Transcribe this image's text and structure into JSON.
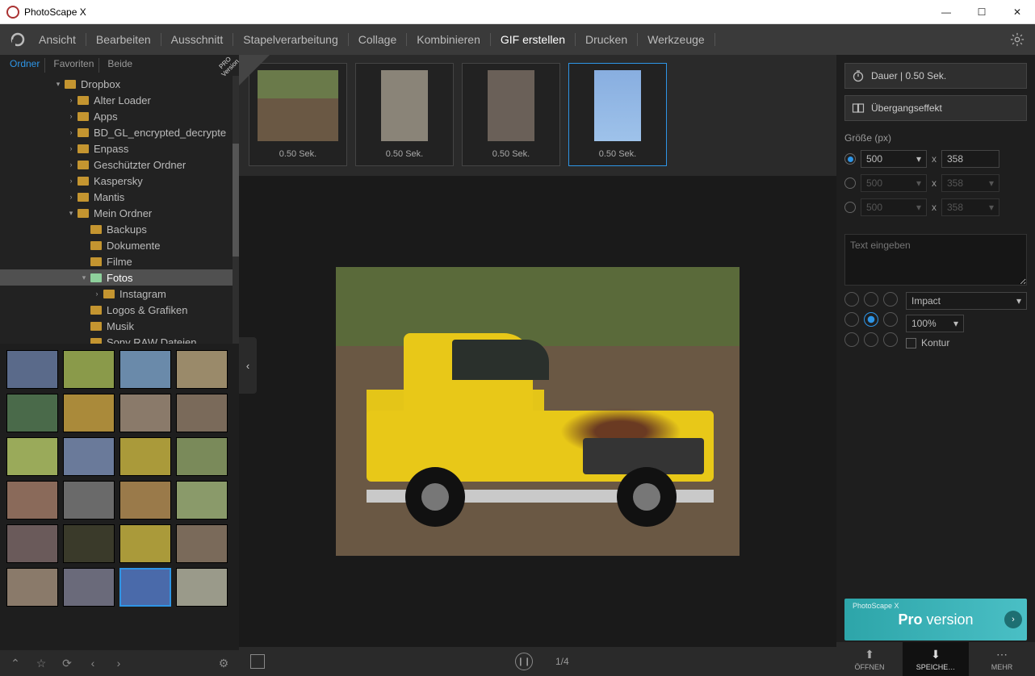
{
  "title": "PhotoScape X",
  "nav": [
    "Ansicht",
    "Bearbeiten",
    "Ausschnitt",
    "Stapelverarbeitung",
    "Collage",
    "Kombinieren",
    "GIF erstellen",
    "Drucken",
    "Werkzeuge"
  ],
  "nav_active": 6,
  "left_tabs": [
    "Ordner",
    "Favoriten",
    "Beide"
  ],
  "left_tab_active": 0,
  "tree": [
    {
      "d": 4,
      "exp": "▾",
      "label": "Dropbox"
    },
    {
      "d": 5,
      "exp": "›",
      "label": "Alter Loader"
    },
    {
      "d": 5,
      "exp": "›",
      "label": "Apps"
    },
    {
      "d": 5,
      "exp": "›",
      "label": "BD_GL_encrypted_decrypte"
    },
    {
      "d": 5,
      "exp": "›",
      "label": "Enpass"
    },
    {
      "d": 5,
      "exp": "›",
      "label": "Geschützter Ordner"
    },
    {
      "d": 5,
      "exp": "›",
      "label": "Kaspersky"
    },
    {
      "d": 5,
      "exp": "›",
      "label": "Mantis"
    },
    {
      "d": 5,
      "exp": "▾",
      "label": "Mein Ordner"
    },
    {
      "d": 6,
      "exp": "",
      "label": "Backups"
    },
    {
      "d": 6,
      "exp": "",
      "label": "Dokumente"
    },
    {
      "d": 6,
      "exp": "",
      "label": "Filme"
    },
    {
      "d": 6,
      "exp": "▾",
      "label": "Fotos",
      "selected": true
    },
    {
      "d": 7,
      "exp": "›",
      "label": "Instagram"
    },
    {
      "d": 6,
      "exp": "",
      "label": "Logos & Grafiken"
    },
    {
      "d": 6,
      "exp": "",
      "label": "Musik"
    },
    {
      "d": 6,
      "exp": "",
      "label": "Sony RAW Dateien"
    }
  ],
  "strip": [
    {
      "time": "0.50 Sek.",
      "cls": "m-truck"
    },
    {
      "time": "0.50 Sek.",
      "cls": "m-dog",
      "tall": true
    },
    {
      "time": "0.50 Sek.",
      "cls": "m-donkey",
      "tall": true
    },
    {
      "time": "0.50 Sek.",
      "cls": "m-ben",
      "tall": true,
      "selected": true
    }
  ],
  "pro_badge": "PRO\nVersion",
  "counter": "1/4",
  "right": {
    "duration": "Dauer | 0.50 Sek.",
    "transition": "Übergangseffekt",
    "size_label": "Größe (px)",
    "sizes": [
      {
        "on": true,
        "w": "500",
        "h": "358"
      },
      {
        "on": false,
        "w": "500",
        "h": "358"
      },
      {
        "on": false,
        "w": "500",
        "h": "358"
      }
    ],
    "x": "x",
    "text_placeholder": "Text eingeben",
    "font": "Impact",
    "pct": "100%",
    "contour": "Kontur",
    "promo_small": "PhotoScape X",
    "promo_main": "Pro version"
  },
  "footer_right": [
    "ÖFFNEN",
    "SPEICHE…",
    "MEHR"
  ],
  "footer_right_sel": 1
}
